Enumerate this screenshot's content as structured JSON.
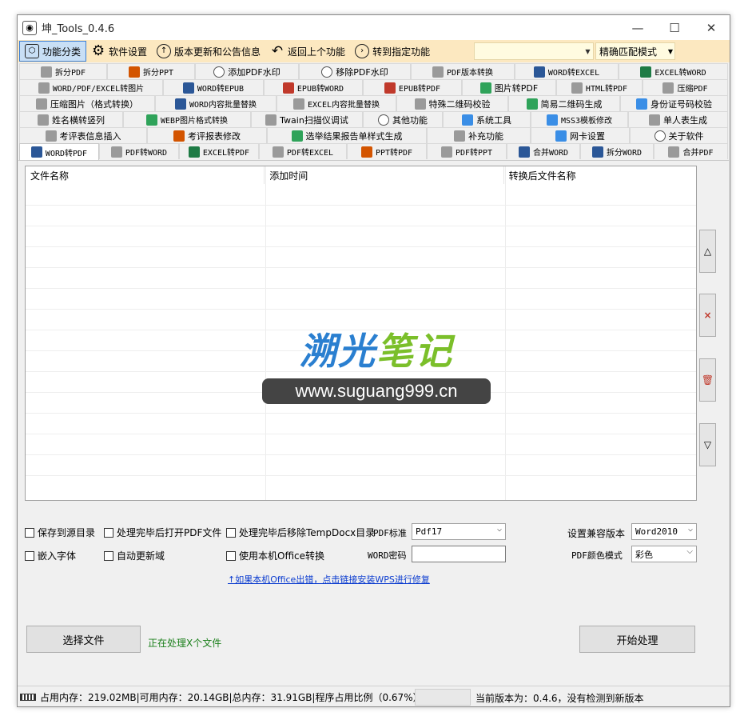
{
  "window": {
    "title": "坤_Tools_0.4.6",
    "minimize": "—",
    "maximize": "☐",
    "close": "✕"
  },
  "toolbar": {
    "classify": "功能分类",
    "settings": "软件设置",
    "update": "版本更新和公告信息",
    "back": "返回上个功能",
    "goto": "转到指定功能",
    "search_value": "",
    "match_mode": "精确匹配模式"
  },
  "tabs": {
    "row1": [
      "拆分PDF",
      "拆分PPT",
      "添加PDF水印",
      "移除PDF水印",
      "PDF版本转换",
      "WORD转EXCEL",
      "EXCEL转WORD"
    ],
    "row2": [
      "WORD/PDF/EXCEL转图片",
      "WORD转EPUB",
      "EPUB转WORD",
      "EPUB转PDF",
      "图片转PDF",
      "HTML转PDF",
      "压缩PDF"
    ],
    "row3": [
      "压缩图片（格式转换）",
      "WORD内容批量替换",
      "EXCEL内容批量替换",
      "特殊二维码校验",
      "简易二维码生成",
      "身份证号码校验"
    ],
    "row4": [
      "姓名横转竖列",
      "WEBP图片格式转换",
      "Twain扫描仪调试",
      "其他功能",
      "系统工具",
      "MSS3模板修改",
      "单人表生成"
    ],
    "row5": [
      "考评表信息插入",
      "考评报表修改",
      "选举结果报告单样式生成",
      "补充功能",
      "网卡设置",
      "关于软件"
    ],
    "row6": [
      "WORD转PDF",
      "PDF转WORD",
      "EXCEL转PDF",
      "PDF转EXCEL",
      "PPT转PDF",
      "PDF转PPT",
      "合并WORD",
      "拆分WORD",
      "合并PDF"
    ]
  },
  "grid": {
    "columns": [
      "文件名称",
      "添加时间",
      "转换后文件名称"
    ],
    "rows": []
  },
  "watermark": {
    "title_blue": "溯光",
    "title_green": "笔记",
    "url": "www.suguang999.cn"
  },
  "side_buttons": {
    "up": "△",
    "remove": "×",
    "clear": "🗑",
    "down": "▽"
  },
  "options": {
    "save_to_source": "保存到源目录",
    "open_pdf_after": "处理完毕后打开PDF文件",
    "remove_temp": "处理完毕后移除TempDocx目录",
    "pdf_standard_label": "PDF标准",
    "pdf_standard_value": "Pdf17",
    "compat_label": "设置兼容版本",
    "compat_value": "Word2010",
    "embed_fonts": "嵌入字体",
    "auto_update_fields": "自动更新域",
    "use_local_office": "使用本机Office转换",
    "word_password_label": "WORD密码",
    "word_password_value": "",
    "pdf_color_label": "PDF颜色模式",
    "pdf_color_value": "彩色"
  },
  "link": "↑如果本机Office出错，点击链接安装WPS进行修复",
  "actions": {
    "select_files": "选择文件",
    "processing": "正在处理X个文件",
    "start": "开始处理"
  },
  "statusbar": {
    "memory": "占用内存：219.02MB|可用内存：20.14GB|总内存：31.91GB|程序占用比例（0.67%）",
    "version": "当前版本为：0.4.6，没有检测到新版本"
  },
  "colors": {
    "toolbar_bg": "#fce8c0",
    "link": "#0a3bcf",
    "processing_text": "#1a7f1a",
    "watermark_blue": "#2a7fd0",
    "watermark_green": "#7bbf2a"
  }
}
